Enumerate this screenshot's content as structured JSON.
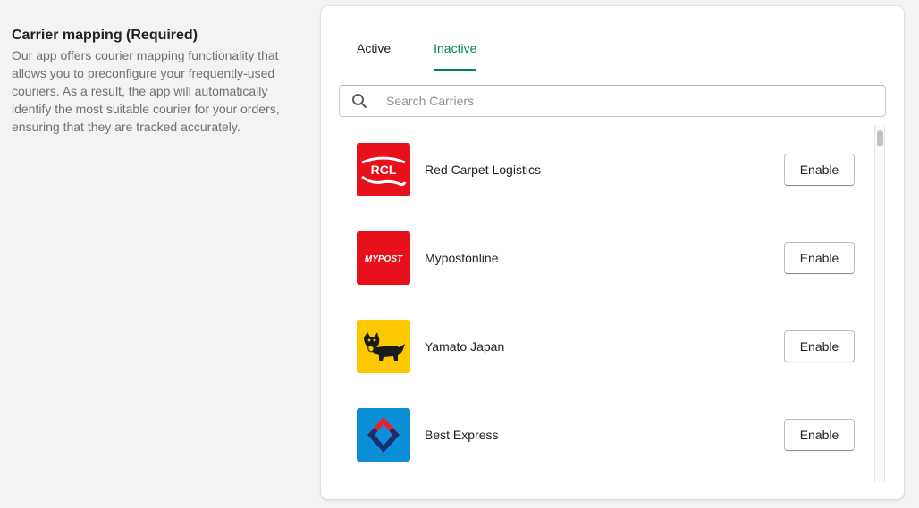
{
  "section": {
    "title": "Carrier mapping (Required)",
    "description": "Our app offers courier mapping functionality that allows you to preconfigure your frequently-used couriers. As a result, the app will automatically identify the most suitable courier for your orders, ensuring that they are tracked accurately."
  },
  "tabs": [
    {
      "label": "Active",
      "selected": false
    },
    {
      "label": "Inactive",
      "selected": true
    }
  ],
  "search": {
    "placeholder": "Search Carriers",
    "value": "",
    "icon": "search-icon"
  },
  "carriers": [
    {
      "name": "Red Carpet Logistics",
      "logo_text": "RCL",
      "logo_color": "#e8111b",
      "action": "Enable"
    },
    {
      "name": "Mypostonline",
      "logo_text": "MYPOST",
      "logo_color": "#e8111b",
      "action": "Enable"
    },
    {
      "name": "Yamato Japan",
      "logo_text": "",
      "logo_color": "#fcc800",
      "action": "Enable"
    },
    {
      "name": "Best Express",
      "logo_text": "",
      "logo_color": "#0a8fd6",
      "action": "Enable"
    }
  ],
  "colors": {
    "accent": "#008060",
    "text": "#202223",
    "muted": "#6d7175"
  }
}
